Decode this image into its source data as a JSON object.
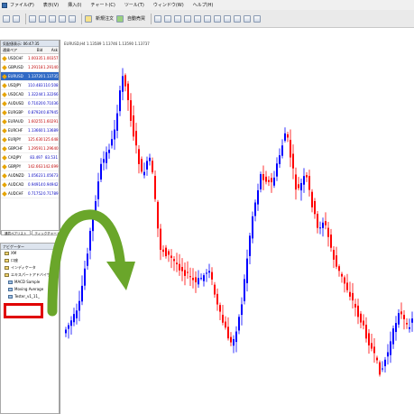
{
  "menu": {
    "items": [
      "ファイル(F)",
      "表示(V)",
      "挿入(I)",
      "チャート(C)",
      "ツール(T)",
      "ウィンドウ(W)",
      "ヘルプ(H)"
    ]
  },
  "toolbar": {
    "new_order_label": "新規注文",
    "auto_trading_label": "自動売買"
  },
  "market_watch": {
    "title": "気配値表示: 06:47:35",
    "col_symbol": "通貨ペア",
    "col_bid": "Bid",
    "col_ask": "Ask",
    "rows": [
      {
        "symbol": "USDCHF",
        "bid": "1.00335",
        "ask": "1.00357",
        "dir": "down",
        "selected": false
      },
      {
        "symbol": "GBPUSD",
        "bid": "1.29118",
        "ask": "1.29140",
        "dir": "down",
        "selected": false
      },
      {
        "symbol": "EURUSD",
        "bid": "1.13720",
        "ask": "1.13735",
        "dir": "up",
        "selected": true
      },
      {
        "symbol": "USDJPY",
        "bid": "110.483",
        "ask": "110.508",
        "dir": "up",
        "selected": false
      },
      {
        "symbol": "USDCAD",
        "bid": "1.32244",
        "ask": "1.32266",
        "dir": "up",
        "selected": false
      },
      {
        "symbol": "AUDUSD",
        "bid": "0.71020",
        "ask": "0.71036",
        "dir": "up",
        "selected": false
      },
      {
        "symbol": "EURGBP",
        "bid": "0.87924",
        "ask": "0.87945",
        "dir": "up",
        "selected": false
      },
      {
        "symbol": "EURAUD",
        "bid": "1.60255",
        "ask": "1.60291",
        "dir": "down",
        "selected": false
      },
      {
        "symbol": "EURCHF",
        "bid": "1.13660",
        "ask": "1.13689",
        "dir": "up",
        "selected": false
      },
      {
        "symbol": "EURJPY",
        "bid": "125.630",
        "ask": "125.648",
        "dir": "down",
        "selected": false
      },
      {
        "symbol": "GBPCHF",
        "bid": "1.29591",
        "ask": "1.29640",
        "dir": "down",
        "selected": false
      },
      {
        "symbol": "CADJPY",
        "bid": "83.497",
        "ask": "83.531",
        "dir": "up",
        "selected": false
      },
      {
        "symbol": "GBPJPY",
        "bid": "142.663",
        "ask": "142.699",
        "dir": "down",
        "selected": false
      },
      {
        "symbol": "AUDNZD",
        "bid": "1.05623",
        "ask": "1.05673",
        "dir": "up",
        "selected": false
      },
      {
        "symbol": "AUDCAD",
        "bid": "0.94914",
        "ask": "0.94942",
        "dir": "up",
        "selected": false
      },
      {
        "symbol": "AUDCHF",
        "bid": "0.71752",
        "ask": "0.71789",
        "dir": "up",
        "selected": false
      }
    ],
    "tab_symbols": "通貨ペアリスト",
    "tab_ticks": "ティックチャート"
  },
  "navigator": {
    "title": "ナビゲーター",
    "items": [
      {
        "label": "XM",
        "indent": 1,
        "kind": "folder"
      },
      {
        "label": "口座",
        "indent": 1,
        "kind": "folder"
      },
      {
        "label": "インディケータ",
        "indent": 1,
        "kind": "folder"
      },
      {
        "label": "エキスパートアドバイザ",
        "indent": 1,
        "kind": "folder"
      },
      {
        "label": "MACD Sample",
        "indent": 2,
        "kind": "ea"
      },
      {
        "label": "Moving Average",
        "indent": 2,
        "kind": "ea"
      },
      {
        "label": "Tester_v1_11_",
        "indent": 2,
        "kind": "ea"
      }
    ]
  },
  "chart": {
    "title": "EURUSD,H4  1.13589 1.13746 1.13590 1.13737",
    "bull_color": "#0000ff",
    "bear_color": "#ff0000",
    "annotation_arrow_color": "#6aa62a",
    "highlight_color": "#e00000"
  }
}
